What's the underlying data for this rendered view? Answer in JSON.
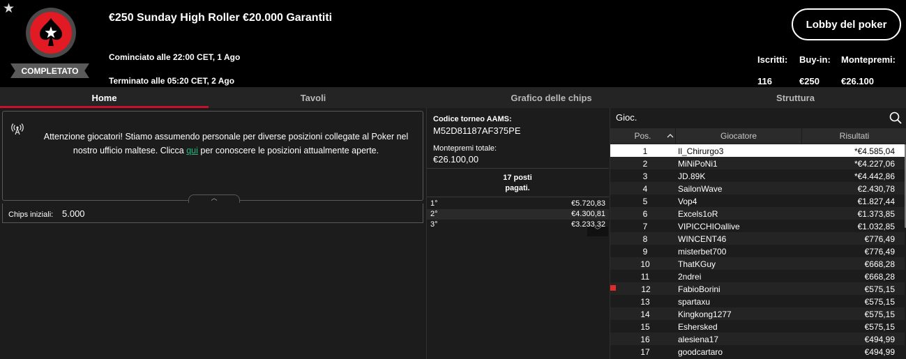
{
  "header": {
    "favorite_icon": "star-icon",
    "logo_icon": "pokerstars-spade-logo",
    "status": "COMPLETATO",
    "title": "€250 Sunday High Roller €20.000 Garantiti",
    "start": "Cominciato alle 22:00 CET, 1 Ago",
    "end": "Terminato alle 05:20 CET, 2 Ago",
    "lobby_button": "Lobby del poker",
    "stats": [
      {
        "label": "Iscritti:",
        "value": "116"
      },
      {
        "label": "Buy-in:",
        "value": "€250"
      },
      {
        "label": "Montepremi:",
        "value": "€26.100"
      }
    ],
    "colors": {
      "brand_red": "#e11a23",
      "accent_red": "#c8102e"
    }
  },
  "tabs": [
    {
      "label": "Home",
      "active": true
    },
    {
      "label": "Tavoli",
      "active": false
    },
    {
      "label": "Grafico delle chips",
      "active": false
    },
    {
      "label": "Struttura",
      "active": false
    }
  ],
  "notice": {
    "icon": "broadcast-antenna-icon",
    "text_before": "Attenzione giocatori! Stiamo assumendo personale per diverse posizioni collegate al Poker nel nostro ufficio maltese. Clicca ",
    "link": "qui",
    "text_after": " per conoscere le posizioni attualmente aperte.",
    "link_color": "#27b57e"
  },
  "chips": {
    "label": "Chips iniziali:",
    "value": "5.000"
  },
  "tournament_info": {
    "aams_label": "Codice torneo AAMS:",
    "aams_code": "M52D81187AF375PE",
    "prize_label": "Montepremi totale:",
    "prize_value": "€26.100,00",
    "paid_line1": "17 posti",
    "paid_line2": "pagati."
  },
  "payouts": [
    {
      "pos": "1°",
      "value": "€5.720,83"
    },
    {
      "pos": "2°",
      "value": "€4.300,81"
    },
    {
      "pos": "3°",
      "value": "€3.233,32"
    }
  ],
  "players_panel": {
    "search_label": "Gioc.",
    "columns": {
      "pos": "Pos.",
      "player": "Giocatore",
      "result": "Risultati"
    }
  },
  "players": [
    {
      "pos": "1",
      "name": "Il_Chirurgo3",
      "result": "*€4.585,04",
      "selected": true
    },
    {
      "pos": "2",
      "name": "MiNiPoNi1",
      "result": "*€4.227,06"
    },
    {
      "pos": "3",
      "name": "JD.89K",
      "result": "*€4.442,86"
    },
    {
      "pos": "4",
      "name": "SailonWave",
      "result": "€2.430,78"
    },
    {
      "pos": "5",
      "name": "Vop4",
      "result": "€1.827,44"
    },
    {
      "pos": "6",
      "name": "Excels1oR",
      "result": "€1.373,85"
    },
    {
      "pos": "7",
      "name": "VIPICCHIOallive",
      "result": "€1.032,85"
    },
    {
      "pos": "8",
      "name": "WINCENT46",
      "result": "€776,49"
    },
    {
      "pos": "9",
      "name": "misterbet700",
      "result": "€776,49"
    },
    {
      "pos": "10",
      "name": "ThatKGuy",
      "result": "€668,28"
    },
    {
      "pos": "11",
      "name": "2ndrei",
      "result": "€668,28"
    },
    {
      "pos": "12",
      "name": "FabioBorini",
      "result": "€575,15",
      "flag": true
    },
    {
      "pos": "13",
      "name": "spartaxu",
      "result": "€575,15"
    },
    {
      "pos": "14",
      "name": "Kingkong1277",
      "result": "€575,15"
    },
    {
      "pos": "15",
      "name": "Eshersked",
      "result": "€575,15"
    },
    {
      "pos": "16",
      "name": "alesiena17",
      "result": "€494,99"
    },
    {
      "pos": "17",
      "name": "goodcartaro",
      "result": "€494,99"
    }
  ]
}
